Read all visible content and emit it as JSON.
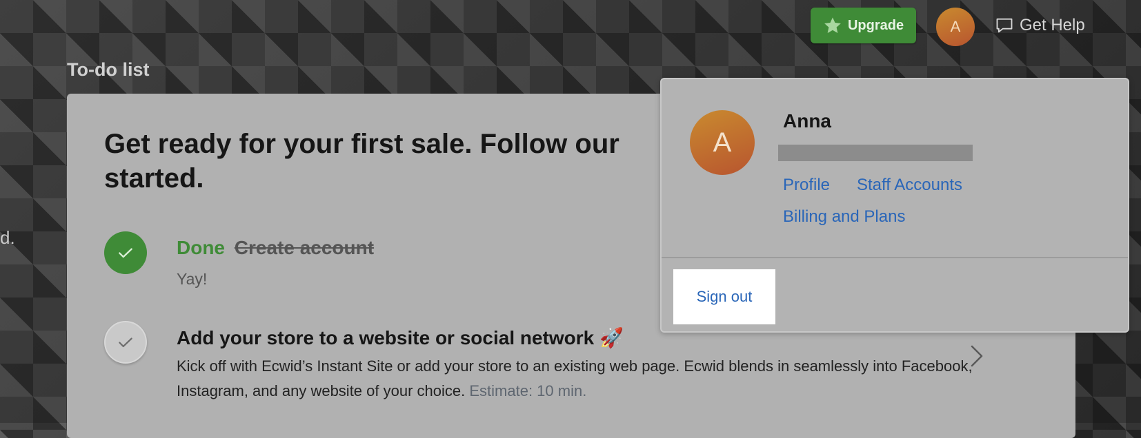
{
  "header": {
    "upgrade_label": "Upgrade",
    "avatar_initial": "A",
    "help_label": "Get Help"
  },
  "page": {
    "section_title": "To-do list",
    "side_fragment": "d."
  },
  "card": {
    "headline": "Get ready for your first sale. Follow our started.",
    "tasks": [
      {
        "status": "Done",
        "title": "Create account",
        "subtitle": "Yay!"
      },
      {
        "title": "Add your store to a website or social network 🚀",
        "description": "Kick off with Ecwid’s Instant Site or add your store to an existing web page. Ecwid blends in seamlessly into Facebook, Instagram, and any website of your choice.",
        "estimate": "Estimate: 10 min."
      }
    ]
  },
  "account_menu": {
    "avatar_initial": "A",
    "name": "Anna",
    "links": {
      "profile": "Profile",
      "staff": "Staff Accounts",
      "billing": "Billing and Plans"
    },
    "sign_out": "Sign out"
  },
  "colors": {
    "accent_green": "#3f8b37",
    "link_blue": "#2a66b8",
    "avatar_orange": "#c0702f"
  }
}
